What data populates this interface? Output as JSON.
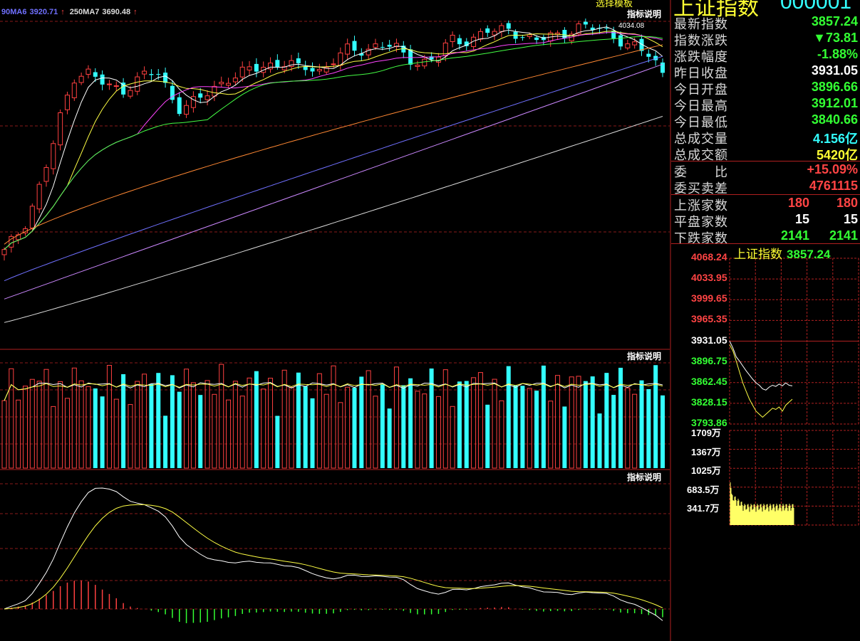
{
  "header": {
    "index_name": "上证指数",
    "index_code": "000001",
    "template_tab": "选择模板"
  },
  "ma_legend": [
    {
      "label": "90MA6",
      "color": "#7070ff"
    },
    {
      "label": "3920.71",
      "color": "#7070ff",
      "arrow": "↑"
    },
    {
      "label": "250MA7",
      "color": "#dddddd"
    },
    {
      "label": "3690.48",
      "color": "#dddddd",
      "arrow": "↑"
    }
  ],
  "indicator_button": "指标说明",
  "peak_label": "4034.08",
  "quote": {
    "latest": {
      "label": "最新指数",
      "value": "3857.24",
      "color": "#33ff33"
    },
    "change": {
      "label": "指数涨跌",
      "value": "▼73.81",
      "color": "#33ff33"
    },
    "pct": {
      "label": "涨跌幅度",
      "value": "-1.88%",
      "color": "#33ff33"
    },
    "prev_close": {
      "label": "昨日收盘",
      "value": "3931.05",
      "color": "#ffffff"
    },
    "open": {
      "label": "今日开盘",
      "value": "3896.66",
      "color": "#33ff33"
    },
    "high": {
      "label": "今日最高",
      "value": "3912.01",
      "color": "#33ff33"
    },
    "low": {
      "label": "今日最低",
      "value": "3840.66",
      "color": "#33ff33"
    },
    "volume": {
      "label": "总成交量",
      "value": "4.156亿",
      "color": "#33ffff"
    },
    "amount": {
      "label": "总成交额",
      "value": "5420亿",
      "color": "#ffff33"
    },
    "wei_bi": {
      "label": "委　　比",
      "value": "+15.09%",
      "color": "#ff4444"
    },
    "wei_cha": {
      "label": "委买卖差",
      "value": "4761115",
      "color": "#ff4444"
    },
    "up_count": {
      "label": "上涨家数",
      "value1": "180",
      "value2": "180",
      "color": "#ff4444"
    },
    "flat_count": {
      "label": "平盘家数",
      "value1": "15",
      "value2": "15",
      "color": "#ffffff"
    },
    "down_count": {
      "label": "下跌家数",
      "value1": "2141",
      "value2": "2141",
      "color": "#33ff33"
    }
  },
  "mini_chart": {
    "title": "上证指数",
    "value": "3857.24",
    "price_ticks": [
      {
        "v": "4068.24",
        "color": "#ff4444"
      },
      {
        "v": "4033.95",
        "color": "#ff4444"
      },
      {
        "v": "3999.65",
        "color": "#ff4444"
      },
      {
        "v": "3965.35",
        "color": "#ff4444"
      },
      {
        "v": "3931.05",
        "color": "#ffffff"
      },
      {
        "v": "3896.75",
        "color": "#33ff33"
      },
      {
        "v": "3862.45",
        "color": "#33ff33"
      },
      {
        "v": "3828.15",
        "color": "#33ff33"
      },
      {
        "v": "3793.86",
        "color": "#33ff33"
      }
    ],
    "volume_ticks": [
      "1709万",
      "1367万",
      "1025万",
      "683.5万",
      "341.7万"
    ]
  },
  "chart_data": {
    "type": "candlestick",
    "description_panels": [
      "price with moving averages",
      "volume",
      "MACD"
    ],
    "candles": {
      "count": 95,
      "anchors_close": [
        3170,
        3230,
        3300,
        3420,
        3560,
        3720,
        3850,
        3860,
        3830,
        3800,
        3790,
        3820,
        3850,
        3860,
        3780,
        3720,
        3740,
        3770,
        3800,
        3840,
        3850,
        3870,
        3880,
        3890,
        3900,
        3870,
        3880,
        3860,
        3910,
        3940,
        3940,
        3950,
        3970,
        3960,
        3920,
        3900,
        3900,
        3930,
        3980,
        3980,
        3990,
        4020,
        4010,
        4030,
        4000,
        3980,
        3990,
        4000,
        4020,
        4030,
        4030,
        4020,
        4000,
        3960,
        3950,
        3920,
        3857
      ],
      "last": {
        "open": 3896.66,
        "high": 3912.01,
        "low": 3840.66,
        "close": 3857.24
      },
      "peak": 4034.08
    },
    "ma": {
      "MA90": 3920.71,
      "MA250": 3690.48
    },
    "mini_intraday": {
      "prev_close": 3931.05,
      "ylim": [
        3793.86,
        4068.24
      ],
      "price": [
        3931,
        3920,
        3905,
        3898,
        3890,
        3882,
        3875,
        3868,
        3862,
        3858,
        3852,
        3850,
        3855,
        3858,
        3856,
        3860,
        3857,
        3862,
        3858,
        3857
      ],
      "avg": [
        3925,
        3915,
        3898,
        3880,
        3862,
        3848,
        3835,
        3825,
        3815,
        3810,
        3805,
        3810,
        3815,
        3820,
        3818,
        3822,
        3815,
        3825,
        3830,
        3835
      ]
    }
  }
}
